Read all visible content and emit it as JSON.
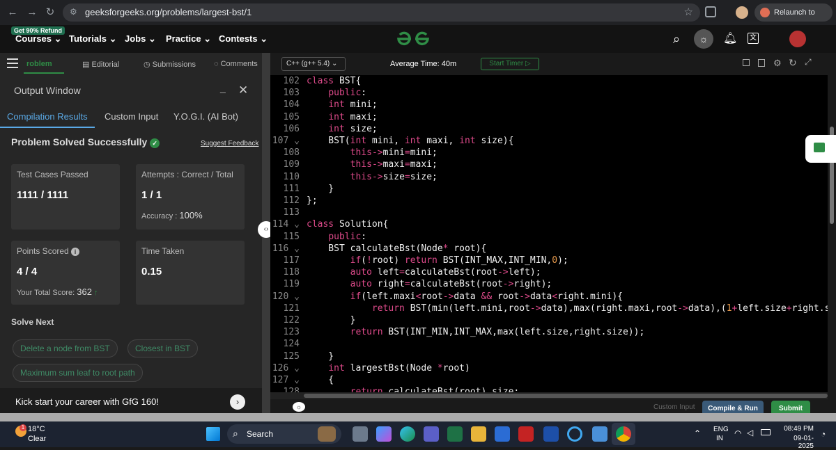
{
  "browser": {
    "url": "geeksforgeeks.org/problems/largest-bst/1",
    "relaunch_label": "Relaunch to update"
  },
  "gfg_nav": {
    "promo_badge": "Get 90% Refund",
    "items": [
      "Courses",
      "Tutorials",
      "Jobs",
      "Practice",
      "Contests"
    ]
  },
  "problem_tabs": {
    "problem": "roblem",
    "editorial": "Editorial",
    "submissions": "Submissions",
    "comments": "Comments"
  },
  "output": {
    "title": "Output Window",
    "tabs": [
      "Compilation Results",
      "Custom Input",
      "Y.O.G.I. (AI Bot)"
    ],
    "status": "Problem Solved Successfully",
    "suggest_feedback": "Suggest Feedback",
    "cards": {
      "test_cases_label": "Test Cases Passed",
      "test_cases_value": "1111 / 1111",
      "attempts_label": "Attempts : Correct / Total",
      "attempts_value": "1 / 1",
      "accuracy_label": "Accuracy :",
      "accuracy_value": "100%",
      "points_label": "Points Scored",
      "points_value": "4 / 4",
      "total_score_label": "Your Total Score:",
      "total_score_value": "362",
      "time_label": "Time Taken",
      "time_value": "0.15"
    },
    "solve_next_title": "Solve Next",
    "solve_next": [
      "Delete a node from BST",
      "Closest in BST",
      "Maximum sum leaf to root path"
    ],
    "career_banner": "Kick start your career with GfG 160!"
  },
  "editor": {
    "language": "C++ (g++ 5.4)",
    "average_time": "Average Time: 40m",
    "start_timer": "Start Timer",
    "line_numbers": [
      "102",
      "103",
      "104",
      "105",
      "106",
      "107",
      "108",
      "109",
      "110",
      "111",
      "112",
      "113",
      "114",
      "115",
      "116",
      "117",
      "118",
      "119",
      "120",
      "121",
      "122",
      "123",
      "124",
      "125",
      "126",
      "127",
      "128"
    ],
    "custom_input": "Custom Input",
    "compile_run": "Compile & Run",
    "submit": "Submit"
  },
  "taskbar": {
    "weather_temp": "18°C",
    "weather_desc": "Clear",
    "weather_badge": "1",
    "search": "Search",
    "lang_top": "ENG",
    "lang_bottom": "IN",
    "time": "08:49 PM",
    "date": "09-01-2025"
  },
  "colors": {
    "gfg_green": "#2f8d46",
    "submit_green": "#2f8d46",
    "keyword_pink": "#dd4a8a",
    "number_orange": "#e89a4c",
    "chip_text": "#3f8b66"
  }
}
